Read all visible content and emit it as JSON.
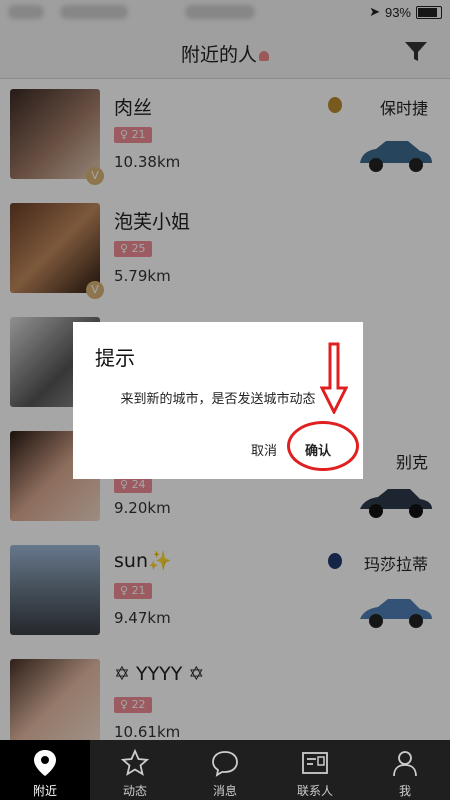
{
  "status": {
    "battery": "93%"
  },
  "header": {
    "title": "附近的人"
  },
  "rows": [
    {
      "name": "肉丝",
      "age": "21",
      "distance": "10.38km",
      "car_brand": "保时捷",
      "car_color": "#3d6a8e",
      "logo_color": "#b98b2e"
    },
    {
      "name": "泡芙小姐",
      "age": "25",
      "distance": "5.79km",
      "car_brand": "",
      "car_color": "",
      "logo_color": ""
    },
    {
      "name": "",
      "age": "",
      "distance": "",
      "car_brand": "",
      "car_color": "",
      "logo_color": ""
    },
    {
      "name": "",
      "age": "24",
      "distance": "9.20km",
      "car_brand": "别克",
      "car_color": "#2c3a4b",
      "logo_color": ""
    },
    {
      "name": "sun✨",
      "age": "21",
      "distance": "9.47km",
      "car_brand": "玛莎拉蒂",
      "car_color": "#4f7fb4",
      "logo_color": "#1f3a6e"
    },
    {
      "name": "✡ YYYY ✡",
      "age": "22",
      "distance": "10.61km",
      "car_brand": "",
      "car_color": "",
      "logo_color": ""
    }
  ],
  "dialog": {
    "title": "提示",
    "message": "来到新的城市，是否发送城市动态",
    "cancel": "取消",
    "confirm": "确认"
  },
  "tabs": [
    {
      "label": "附近",
      "icon": "location-pin-icon"
    },
    {
      "label": "动态",
      "icon": "star-icon"
    },
    {
      "label": "消息",
      "icon": "chat-bubble-icon"
    },
    {
      "label": "联系人",
      "icon": "contact-card-icon"
    },
    {
      "label": "我",
      "icon": "person-icon"
    }
  ],
  "colors": {
    "accent": "#f08c96",
    "highlight": "#e02020",
    "tabbar": "#1f1f1f"
  }
}
